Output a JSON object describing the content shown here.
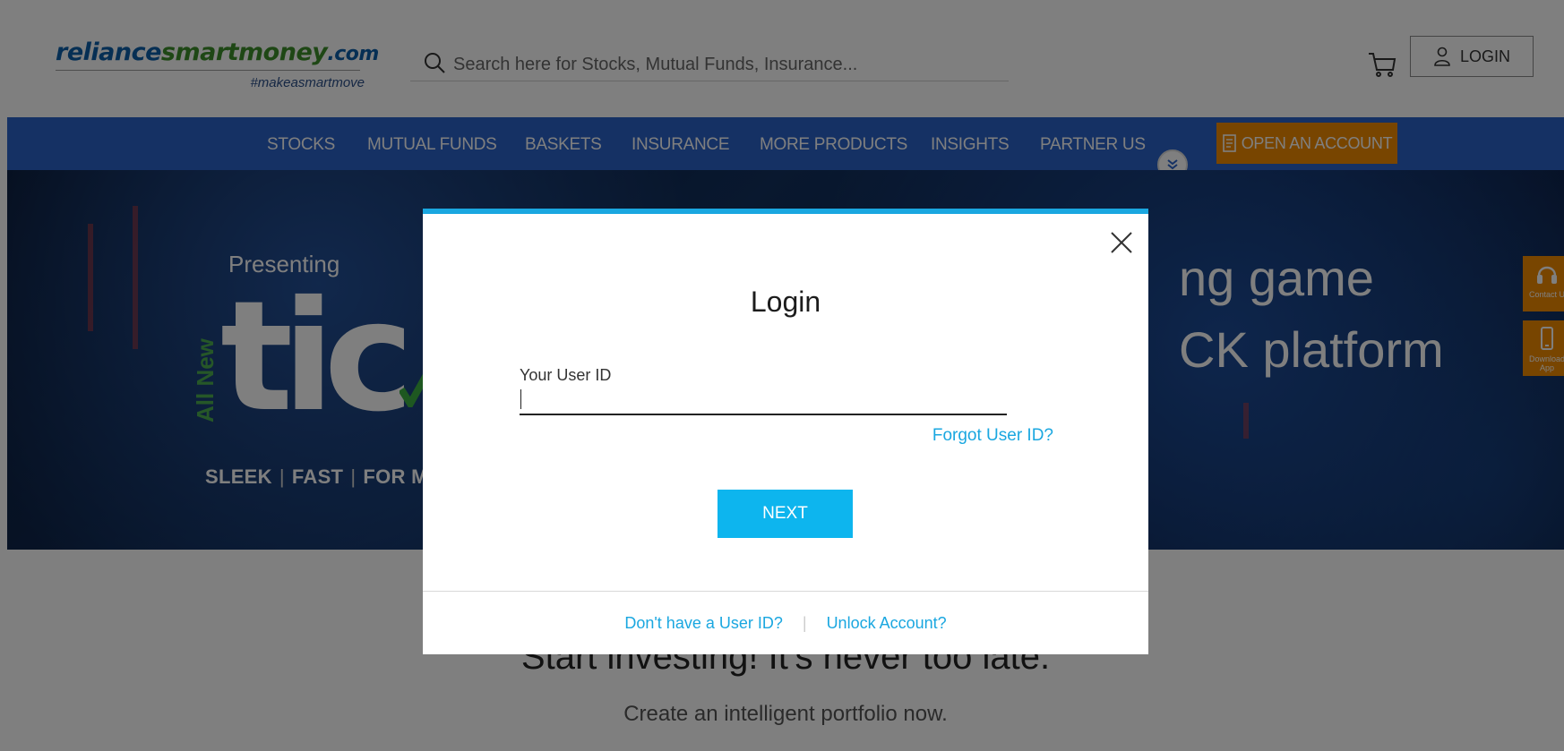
{
  "header": {
    "logo": {
      "part1": "reliance",
      "part2": "smartmoney",
      "part3": ".com",
      "tagline": "#makeasmartmove"
    },
    "search_placeholder": "Search here for Stocks, Mutual Funds, Insurance...",
    "login_label": "LOGIN"
  },
  "nav": {
    "items": [
      "STOCKS",
      "MUTUAL FUNDS",
      "BASKETS",
      "INSURANCE",
      "MORE PRODUCTS",
      "INSIGHTS",
      "PARTNER US"
    ],
    "open_account_label": "OPEN AN ACCOUNT"
  },
  "banner": {
    "presenting": "Presenting",
    "all_new": "All New",
    "product": "tic",
    "features": [
      "SLEEK",
      "FAST",
      "FOR M"
    ],
    "headline_line1": "ng game",
    "headline_line2": "CK platform"
  },
  "side_tabs": [
    {
      "label": "Contact U",
      "icon": "headset-icon"
    },
    {
      "label": "Download App",
      "icon": "mobile-icon"
    }
  ],
  "main": {
    "headline": "Start investing! It's never too late.",
    "subheadline": "Create an intelligent portfolio now."
  },
  "modal": {
    "title": "Login",
    "user_id_label": "Your User ID",
    "user_id_value": "",
    "forgot_label": "Forgot User ID?",
    "next_label": "NEXT",
    "no_user_id_label": "Don't have a User ID?",
    "unlock_label": "Unlock Account?"
  },
  "colors": {
    "nav_blue": "#2a63c8",
    "accent_orange": "#f18a00",
    "modal_accent": "#1aa7e0",
    "next_button": "#0db5ee"
  }
}
